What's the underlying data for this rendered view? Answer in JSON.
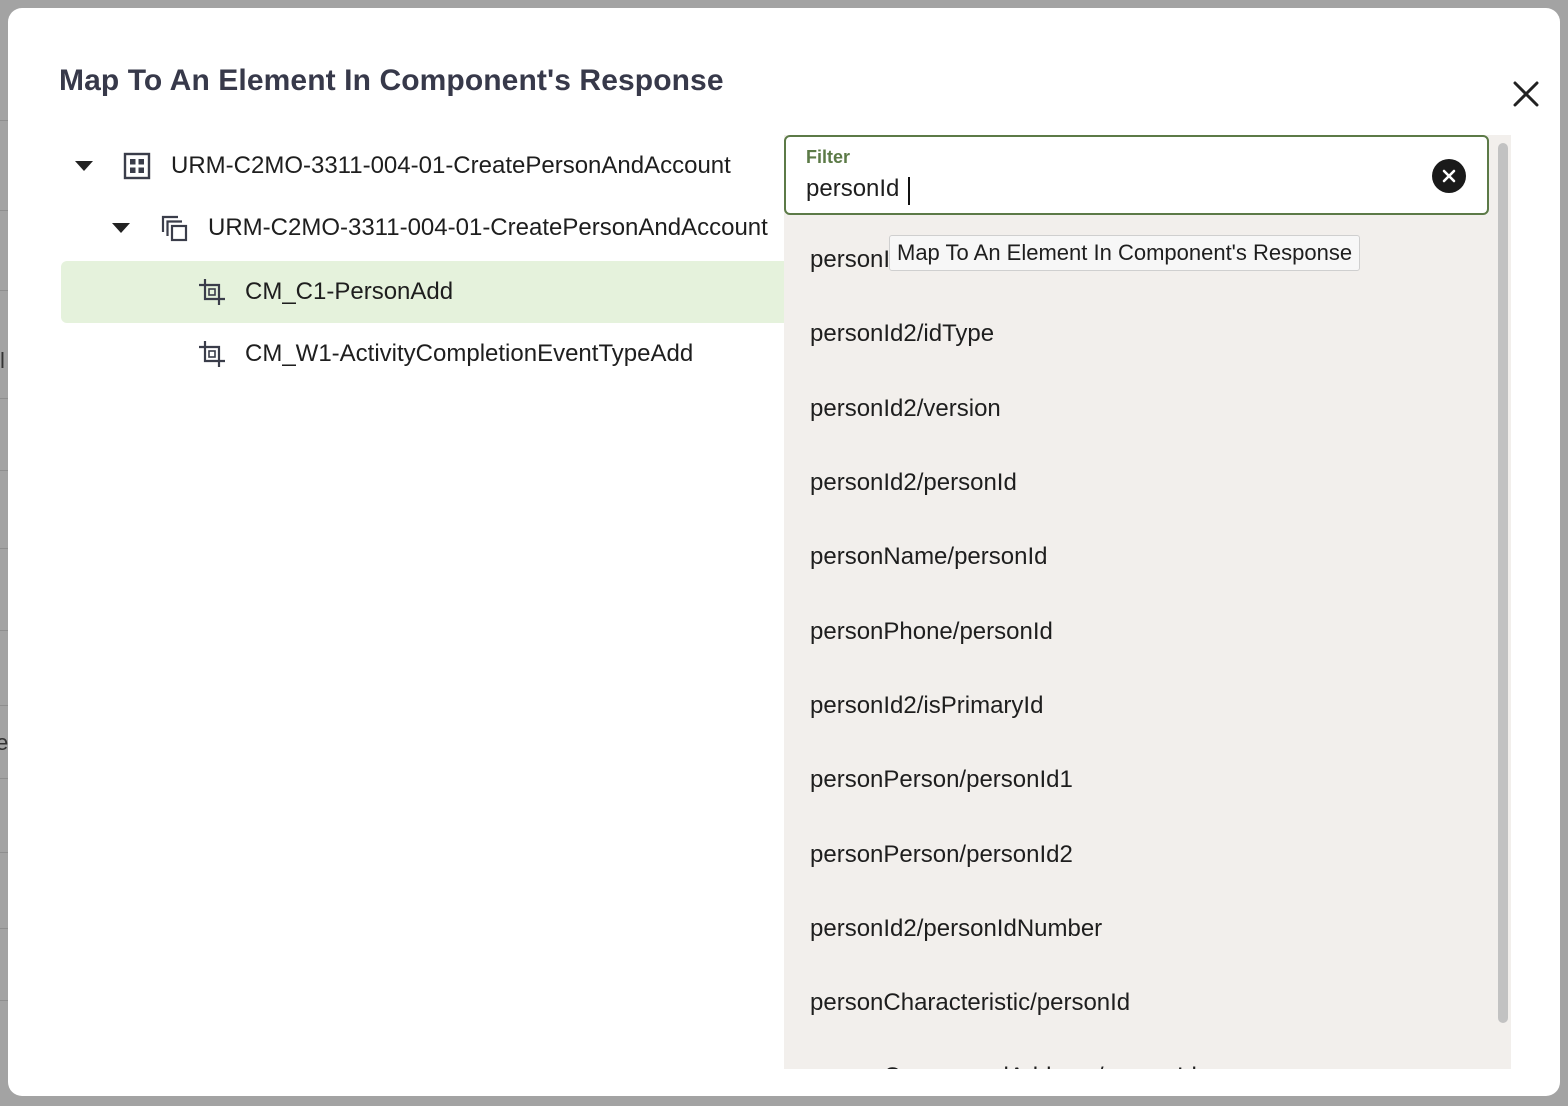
{
  "background": {
    "glyph_a": "l",
    "glyph_b": "e"
  },
  "dialog": {
    "title": "Map To An Element In Component's Response",
    "close_icon": "close-icon"
  },
  "tree": {
    "items": [
      {
        "label": "URM-C2MO-3311-004-01-CreatePersonAndAccount",
        "icon": "grid-icon",
        "expanded": true
      },
      {
        "label": "URM-C2MO-3311-004-01-CreatePersonAndAccount",
        "icon": "copy-stack-icon",
        "expanded": true
      },
      {
        "label": "CM_C1-PersonAdd",
        "icon": "crop-icon",
        "selected": true
      },
      {
        "label": "CM_W1-ActivityCompletionEventTypeAdd",
        "icon": "crop-icon"
      }
    ]
  },
  "filter": {
    "label": "Filter",
    "value": "personId",
    "clear_icon": "clear-circle-icon",
    "options": [
      "personId",
      "personId2/idType",
      "personId2/version",
      "personId2/personId",
      "personName/personId",
      "personPhone/personId",
      "personId2/isPrimaryId",
      "personPerson/personId1",
      "personPerson/personId2",
      "personId2/personIdNumber",
      "personCharacteristic/personId",
      "personCorrespondAddress/personId"
    ]
  },
  "tooltip": {
    "text": "Map To An Element In Component's Response"
  },
  "colors": {
    "accent": "#5c7a47",
    "selected_row": "#e5f2dc",
    "popup_bg": "#f2efec",
    "title": "#37394a"
  }
}
